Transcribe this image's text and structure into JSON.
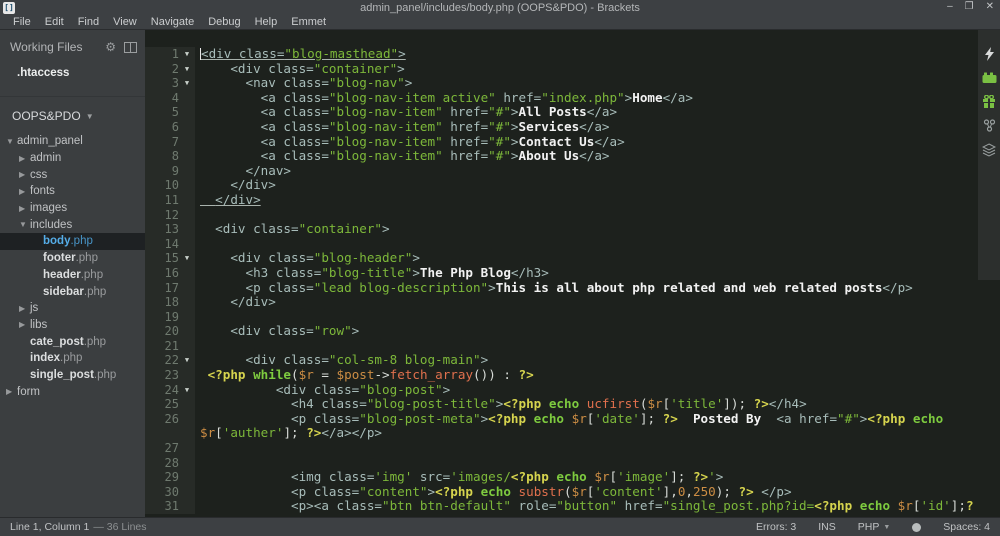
{
  "window": {
    "title": "admin_panel/includes/body.php (OOPS&PDO) - Brackets",
    "minimize": "–",
    "maximize": "❐",
    "close": "✕"
  },
  "menu": {
    "items": [
      "File",
      "Edit",
      "Find",
      "View",
      "Navigate",
      "Debug",
      "Help",
      "Emmet"
    ]
  },
  "sidebar": {
    "working_files_label": "Working Files",
    "working_files": [
      ".htaccess"
    ],
    "project_name": "OOPS&PDO",
    "tree": [
      {
        "label": "admin_panel",
        "level": 0,
        "kind": "folder",
        "state": "expanded"
      },
      {
        "label": "admin",
        "level": 1,
        "kind": "folder",
        "state": "collapsed"
      },
      {
        "label": "css",
        "level": 1,
        "kind": "folder",
        "state": "collapsed"
      },
      {
        "label": "fonts",
        "level": 1,
        "kind": "folder",
        "state": "collapsed"
      },
      {
        "label": "images",
        "level": 1,
        "kind": "folder",
        "state": "collapsed"
      },
      {
        "label": "includes",
        "level": 1,
        "kind": "folder",
        "state": "expanded"
      },
      {
        "label": "body.php",
        "level": 2,
        "kind": "file",
        "selected": true
      },
      {
        "label": "footer.php",
        "level": 2,
        "kind": "file"
      },
      {
        "label": "header.php",
        "level": 2,
        "kind": "file"
      },
      {
        "label": "sidebar.php",
        "level": 2,
        "kind": "file"
      },
      {
        "label": "js",
        "level": 1,
        "kind": "folder",
        "state": "collapsed"
      },
      {
        "label": "libs",
        "level": 1,
        "kind": "folder",
        "state": "collapsed"
      },
      {
        "label": "cate_post.php",
        "level": 1,
        "kind": "file"
      },
      {
        "label": "index.php",
        "level": 1,
        "kind": "file"
      },
      {
        "label": "single_post.php",
        "level": 1,
        "kind": "file"
      },
      {
        "label": "form",
        "level": 0,
        "kind": "folder",
        "state": "collapsed"
      }
    ]
  },
  "editor": {
    "lines": [
      {
        "num": 1,
        "fold": true,
        "underline": true,
        "cursor": true,
        "segments": [
          [
            "t",
            "<div class="
          ],
          [
            "s",
            "\"blog-masthead\""
          ],
          [
            "t",
            ">"
          ]
        ]
      },
      {
        "num": 2,
        "fold": true,
        "segments": [
          [
            "t",
            "    <div class="
          ],
          [
            "s",
            "\"container\""
          ],
          [
            "t",
            ">"
          ]
        ]
      },
      {
        "num": 3,
        "fold": true,
        "segments": [
          [
            "t",
            "      <nav class="
          ],
          [
            "s",
            "\"blog-nav\""
          ],
          [
            "t",
            ">"
          ]
        ]
      },
      {
        "num": 4,
        "segments": [
          [
            "t",
            "        <a class="
          ],
          [
            "s",
            "\"blog-nav-item active\""
          ],
          [
            "t",
            " href="
          ],
          [
            "s",
            "\"index.php\""
          ],
          [
            "t",
            ">"
          ],
          [
            "w",
            "Home"
          ],
          [
            "t",
            "</a>"
          ]
        ]
      },
      {
        "num": 5,
        "segments": [
          [
            "t",
            "        <a class="
          ],
          [
            "s",
            "\"blog-nav-item\""
          ],
          [
            "t",
            " href="
          ],
          [
            "s",
            "\"#\""
          ],
          [
            "t",
            ">"
          ],
          [
            "w",
            "All Posts"
          ],
          [
            "t",
            "</a>"
          ]
        ]
      },
      {
        "num": 6,
        "segments": [
          [
            "t",
            "        <a class="
          ],
          [
            "s",
            "\"blog-nav-item\""
          ],
          [
            "t",
            " href="
          ],
          [
            "s",
            "\"#\""
          ],
          [
            "t",
            ">"
          ],
          [
            "w",
            "Services"
          ],
          [
            "t",
            "</a>"
          ]
        ]
      },
      {
        "num": 7,
        "segments": [
          [
            "t",
            "        <a class="
          ],
          [
            "s",
            "\"blog-nav-item\""
          ],
          [
            "t",
            " href="
          ],
          [
            "s",
            "\"#\""
          ],
          [
            "t",
            ">"
          ],
          [
            "w",
            "Contact Us"
          ],
          [
            "t",
            "</a>"
          ]
        ]
      },
      {
        "num": 8,
        "segments": [
          [
            "t",
            "        <a class="
          ],
          [
            "s",
            "\"blog-nav-item\""
          ],
          [
            "t",
            " href="
          ],
          [
            "s",
            "\"#\""
          ],
          [
            "t",
            ">"
          ],
          [
            "w",
            "About Us"
          ],
          [
            "t",
            "</a>"
          ]
        ]
      },
      {
        "num": 9,
        "segments": [
          [
            "t",
            "      </nav>"
          ]
        ]
      },
      {
        "num": 10,
        "segments": [
          [
            "t",
            "    </div>"
          ]
        ]
      },
      {
        "num": 11,
        "underline": true,
        "segments": [
          [
            "t",
            "  </div>"
          ]
        ]
      },
      {
        "num": 12,
        "segments": []
      },
      {
        "num": 13,
        "segments": [
          [
            "t",
            "  <div class="
          ],
          [
            "s",
            "\"container\""
          ],
          [
            "t",
            ">"
          ]
        ]
      },
      {
        "num": 14,
        "segments": []
      },
      {
        "num": 15,
        "fold": true,
        "segments": [
          [
            "t",
            "    <div class="
          ],
          [
            "s",
            "\"blog-header\""
          ],
          [
            "t",
            ">"
          ]
        ]
      },
      {
        "num": 16,
        "segments": [
          [
            "t",
            "      <h3 class="
          ],
          [
            "s",
            "\"blog-title\""
          ],
          [
            "t",
            ">"
          ],
          [
            "w",
            "The Php Blog"
          ],
          [
            "t",
            "</h3>"
          ]
        ]
      },
      {
        "num": 17,
        "segments": [
          [
            "t",
            "      <p class="
          ],
          [
            "s",
            "\"lead blog-description\""
          ],
          [
            "t",
            ">"
          ],
          [
            "w",
            "This is all about php related and web related posts"
          ],
          [
            "t",
            "</p>"
          ]
        ]
      },
      {
        "num": 18,
        "segments": [
          [
            "t",
            "    </div>"
          ]
        ]
      },
      {
        "num": 19,
        "segments": []
      },
      {
        "num": 20,
        "segments": [
          [
            "t",
            "    <div class="
          ],
          [
            "s",
            "\"row\""
          ],
          [
            "t",
            ">"
          ]
        ]
      },
      {
        "num": 21,
        "segments": []
      },
      {
        "num": 22,
        "fold": true,
        "segments": [
          [
            "t",
            "      <div class="
          ],
          [
            "s",
            "\"col-sm-8 blog-main\""
          ],
          [
            "t",
            ">"
          ]
        ]
      },
      {
        "num": 23,
        "segments": [
          [
            "p",
            " <?php "
          ],
          [
            "k",
            "while"
          ],
          [
            "d",
            "("
          ],
          [
            "v",
            "$r"
          ],
          [
            "d",
            " = "
          ],
          [
            "v",
            "$post"
          ],
          [
            "d",
            "->"
          ],
          [
            "f",
            "fetch_array"
          ],
          [
            "d",
            "()) : "
          ],
          [
            "p",
            "?>"
          ]
        ]
      },
      {
        "num": 24,
        "fold": true,
        "segments": [
          [
            "t",
            "          <div class="
          ],
          [
            "s",
            "\"blog-post\""
          ],
          [
            "t",
            ">"
          ]
        ]
      },
      {
        "num": 25,
        "segments": [
          [
            "t",
            "            <h4 class="
          ],
          [
            "s",
            "\"blog-post-title\""
          ],
          [
            "t",
            ">"
          ],
          [
            "p",
            "<?php "
          ],
          [
            "k",
            "echo"
          ],
          [
            "d",
            " "
          ],
          [
            "f",
            "ucfirst"
          ],
          [
            "d",
            "("
          ],
          [
            "v",
            "$r"
          ],
          [
            "d",
            "["
          ],
          [
            "s",
            "'title'"
          ],
          [
            "d",
            "]); "
          ],
          [
            "p",
            "?>"
          ],
          [
            "t",
            "</h4>"
          ]
        ]
      },
      {
        "num": 26,
        "segments": [
          [
            "t",
            "            <p class="
          ],
          [
            "s",
            "\"blog-post-meta\""
          ],
          [
            "t",
            ">"
          ],
          [
            "p",
            "<?php "
          ],
          [
            "k",
            "echo"
          ],
          [
            "d",
            " "
          ],
          [
            "v",
            "$r"
          ],
          [
            "d",
            "["
          ],
          [
            "s",
            "'date'"
          ],
          [
            "d",
            "]; "
          ],
          [
            "p",
            "?>"
          ],
          [
            "w",
            "  Posted By  "
          ],
          [
            "t",
            "<a href="
          ],
          [
            "s",
            "\"#\""
          ],
          [
            "t",
            ">"
          ],
          [
            "p",
            "<?php "
          ],
          [
            "k",
            "echo"
          ],
          [
            "d",
            " "
          ],
          [
            "v",
            "$r"
          ],
          [
            "d",
            "["
          ],
          [
            "s",
            "'auther'"
          ],
          [
            "d",
            "]; "
          ],
          [
            "p",
            "?>"
          ],
          [
            "t",
            "</a></p>"
          ]
        ]
      },
      {
        "num": 27,
        "segments": []
      },
      {
        "num": 28,
        "segments": []
      },
      {
        "num": 29,
        "segments": [
          [
            "t",
            "            <img class="
          ],
          [
            "s",
            "'img'"
          ],
          [
            "t",
            " src="
          ],
          [
            "s",
            "'images/"
          ],
          [
            "p",
            "<?php "
          ],
          [
            "k",
            "echo"
          ],
          [
            "d",
            " "
          ],
          [
            "v",
            "$r"
          ],
          [
            "d",
            "["
          ],
          [
            "s",
            "'image'"
          ],
          [
            "d",
            "]; "
          ],
          [
            "p",
            "?>"
          ],
          [
            "s",
            "'"
          ],
          [
            "t",
            ">"
          ]
        ]
      },
      {
        "num": 30,
        "segments": [
          [
            "t",
            "            <p class="
          ],
          [
            "s",
            "\"content\""
          ],
          [
            "t",
            ">"
          ],
          [
            "p",
            "<?php "
          ],
          [
            "k",
            "echo"
          ],
          [
            "d",
            " "
          ],
          [
            "f",
            "substr"
          ],
          [
            "d",
            "("
          ],
          [
            "v",
            "$r"
          ],
          [
            "d",
            "["
          ],
          [
            "s",
            "'content'"
          ],
          [
            "d",
            "],"
          ],
          [
            "n",
            "0"
          ],
          [
            "d",
            ","
          ],
          [
            "n",
            "250"
          ],
          [
            "d",
            "); "
          ],
          [
            "p",
            "?>"
          ],
          [
            "d",
            " "
          ],
          [
            "t",
            "</p>"
          ]
        ]
      },
      {
        "num": 31,
        "segments": [
          [
            "t",
            "            <p><a class="
          ],
          [
            "s",
            "\"btn btn-default\""
          ],
          [
            "t",
            " role="
          ],
          [
            "s",
            "\"button\""
          ],
          [
            "t",
            " href="
          ],
          [
            "s",
            "\"single_post.php?id="
          ],
          [
            "p",
            "<?php "
          ],
          [
            "k",
            "echo"
          ],
          [
            "d",
            " "
          ],
          [
            "v",
            "$r"
          ],
          [
            "d",
            "["
          ],
          [
            "s",
            "'id'"
          ],
          [
            "d",
            "];"
          ],
          [
            "p",
            "?"
          ]
        ]
      }
    ]
  },
  "statusbar": {
    "cursor_info": "Line 1, Column 1",
    "lines_info": "— 36 Lines",
    "errors": "Errors: 3",
    "overwrite_toggle": "INS",
    "language": "PHP",
    "indent_info": "Spaces: 4"
  }
}
